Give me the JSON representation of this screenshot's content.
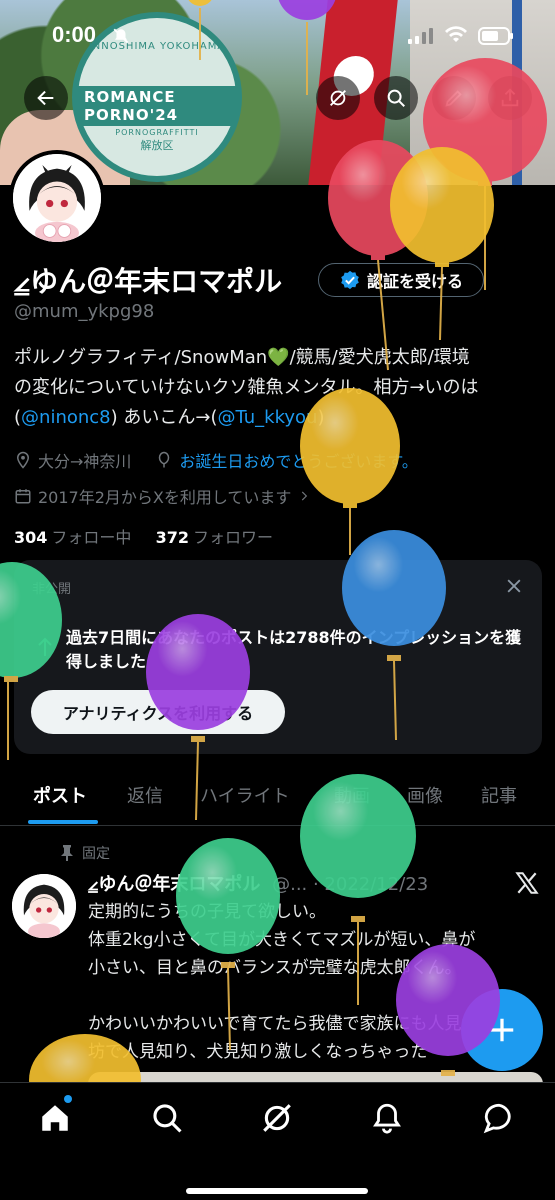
{
  "status_bar": {
    "time": "0:00"
  },
  "banner": {
    "sticker_top": "INNOSHIMA YOKOHAMA",
    "sticker_main": "ROMANCE PORNO'24",
    "sticker_sub": "PORNOGRAFFITTI",
    "sticker_small": "解放区"
  },
  "profile": {
    "display_name": "⦤ゆん＠年末ロマポル",
    "verify_button": "認証を受ける",
    "handle": "@mum_ykpg98",
    "bio": {
      "line1": "ポルノグラフィティ/SnowMan💚/競馬/愛犬虎太郎/環境",
      "line2": "の変化についていけないクソ雑魚メンタル。相方→いのは",
      "line3_open": "(",
      "line3_link1": "@ninonc8",
      "line3_mid": ") あいこん→(",
      "line3_link2": "@Tu_kkyou",
      "line3_close": ")"
    },
    "location": "大分→神奈川",
    "birthday": "お誕生日おめでとうございます。",
    "joined": "2017年2月からXを利用しています",
    "following_count": "304",
    "following_label": "フォロー中",
    "followers_count": "372",
    "followers_label": "フォロワー"
  },
  "card": {
    "private_label": "非公開",
    "impression_text": "過去7日間にあなたのポストは2788件のインプレッションを獲得しました",
    "analytics_button": "アナリティクスを利用する"
  },
  "tabs": [
    {
      "label": "ポスト",
      "active": true
    },
    {
      "label": "返信"
    },
    {
      "label": "ハイライト"
    },
    {
      "label": "動画"
    },
    {
      "label": "画像"
    },
    {
      "label": "記事"
    }
  ],
  "post": {
    "pinned_label": "固定",
    "author": "⦤ゆん＠年末ロマポル",
    "meta": "@... · 2022/12/23",
    "lines": [
      "定期的にうちの子見て欲しい。",
      "体重2kg小さくて目が大きくてマズルが短い、鼻が",
      "小さい、目と鼻のバランスが完璧な虎太郎くん。",
      "",
      "かわいいかわいいで育てたら我儘で家族にも人見知",
      "坊で人見知り、犬見知り激しくなっちゃった"
    ]
  },
  "colors": {
    "accent": "#1d9bf0",
    "balloon_red": "#e9495f",
    "balloon_yellow": "#f2bf2f",
    "balloon_blue": "#3b8fe0",
    "balloon_purple": "#9b3fe0",
    "balloon_green": "#3ecf8e"
  },
  "icons": {
    "back": "arrow-left-icon",
    "grok": "grok-icon",
    "search": "search-icon",
    "edit": "edit-icon",
    "share": "share-icon",
    "home": "home-icon",
    "notifications": "bell-icon",
    "messages": "message-icon",
    "compose": "plus-icon"
  }
}
